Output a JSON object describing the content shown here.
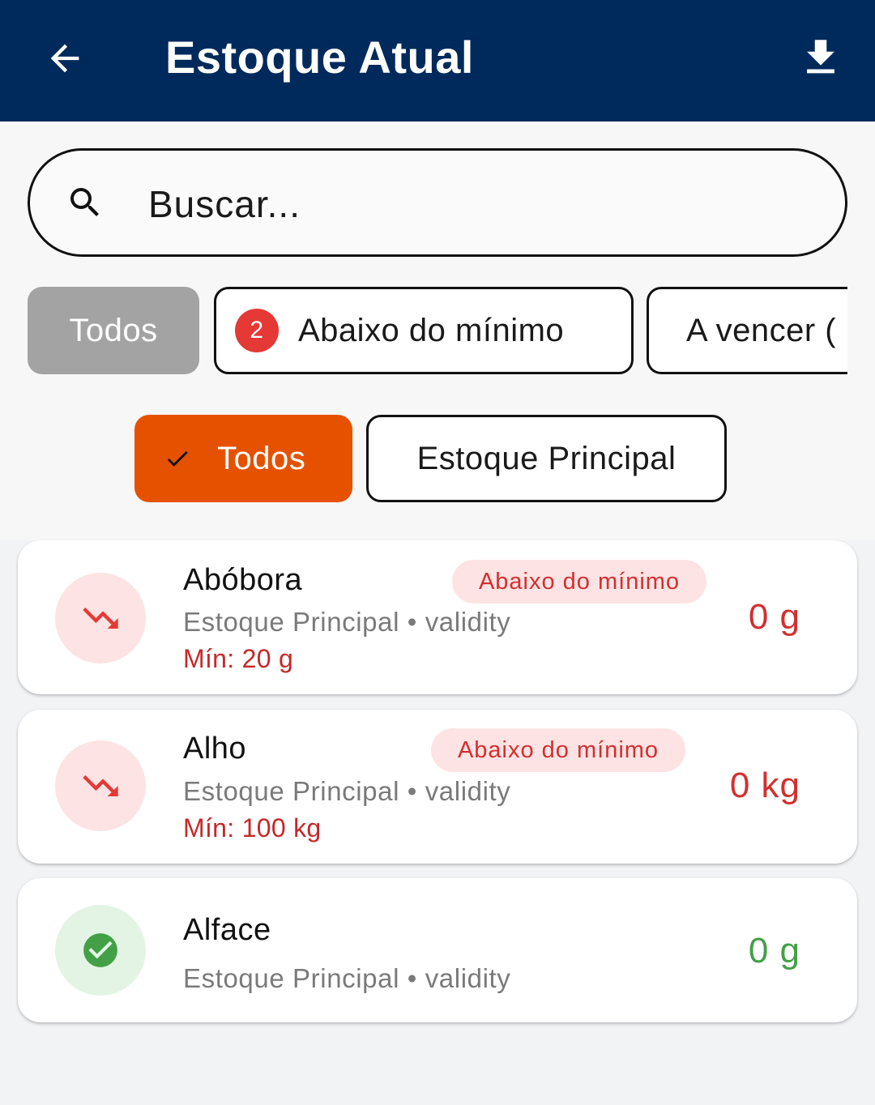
{
  "appbar": {
    "title": "Estoque Atual",
    "back_icon": "arrow-back-icon",
    "download_icon": "download-icon",
    "background": "#002a5c"
  },
  "search": {
    "placeholder": "Buscar...",
    "icon": "search-icon"
  },
  "status_filters": [
    {
      "label": "Todos",
      "selected": true
    },
    {
      "label": "Abaixo do mínimo",
      "count": "2",
      "selected": false
    },
    {
      "label": "A vencer (",
      "selected": false
    }
  ],
  "location_filters": [
    {
      "label": "Todos",
      "selected": true,
      "icon": "check-icon"
    },
    {
      "label": "Estoque Principal",
      "selected": false
    }
  ],
  "items": [
    {
      "name": "Abóbora",
      "meta": "Estoque Principal • validity",
      "min": "Mín: 20 g",
      "tag": "Abaixo do mínimo",
      "quantity": "0 g",
      "status": "below-minimum",
      "icon": "trending-down-icon"
    },
    {
      "name": "Alho",
      "meta": "Estoque Principal • validity",
      "min": "Mín: 100 kg",
      "tag": "Abaixo do mínimo",
      "quantity": "0 kg",
      "status": "below-minimum",
      "icon": "trending-down-icon"
    },
    {
      "name": "Alface",
      "meta": "Estoque Principal • validity",
      "quantity": "0 g",
      "status": "ok",
      "icon": "check-circle-icon"
    }
  ],
  "colors": {
    "accent_orange": "#e65100",
    "alert_red": "#d32f2f",
    "ok_green": "#43a047"
  }
}
